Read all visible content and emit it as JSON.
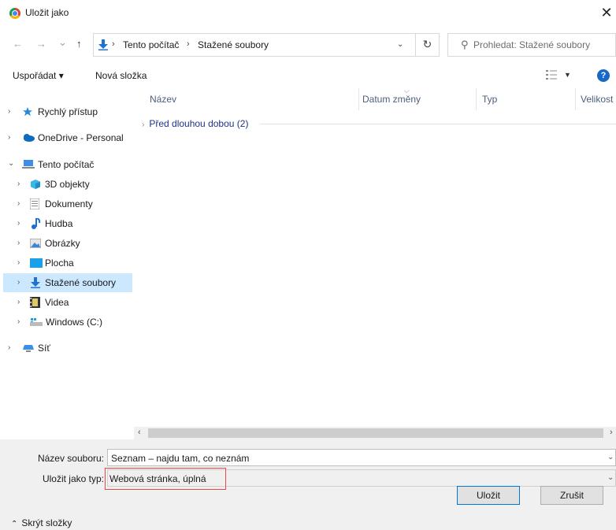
{
  "window": {
    "title": "Uložit jako",
    "close": "✕"
  },
  "nav": {
    "back": "←",
    "forward": "→",
    "recent": "⌄",
    "up": "↑",
    "breadcrumb": [
      "Tento počítač",
      "Stažené soubory"
    ],
    "sep": "›",
    "search_placeholder": "Prohledat: Stažené soubory"
  },
  "toolbar": {
    "organize": "Uspořádat ▾",
    "new_folder": "Nová složka",
    "help": "?"
  },
  "sidebar": {
    "items": [
      {
        "label": "Rychlý přístup"
      },
      {
        "label": "OneDrive - Personal"
      },
      {
        "label": "Tento počítač"
      },
      {
        "label": "3D objekty"
      },
      {
        "label": "Dokumenty"
      },
      {
        "label": "Hudba"
      },
      {
        "label": "Obrázky"
      },
      {
        "label": "Plocha"
      },
      {
        "label": "Stažené soubory"
      },
      {
        "label": "Videa"
      },
      {
        "label": "Windows (C:)"
      },
      {
        "label": "Síť"
      }
    ]
  },
  "columns": [
    "Název",
    "Datum změny",
    "Typ",
    "Velikost"
  ],
  "groups": [
    {
      "label": "Před dlouhou dobou (2)"
    }
  ],
  "form": {
    "filename_label": "Název souboru:",
    "filename_value": "Seznam – najdu tam, co neznám",
    "type_label": "Uložit jako typ:",
    "type_value": "Webová stránka, úplná"
  },
  "buttons": {
    "save": "Uložit",
    "cancel": "Zrušit"
  },
  "toggle_folders": "Skrýt složky",
  "colors": {
    "accent": "#0078d7",
    "selection": "#cce8ff",
    "highlight_border": "#e84a4a",
    "help_bg": "#1868c7"
  }
}
